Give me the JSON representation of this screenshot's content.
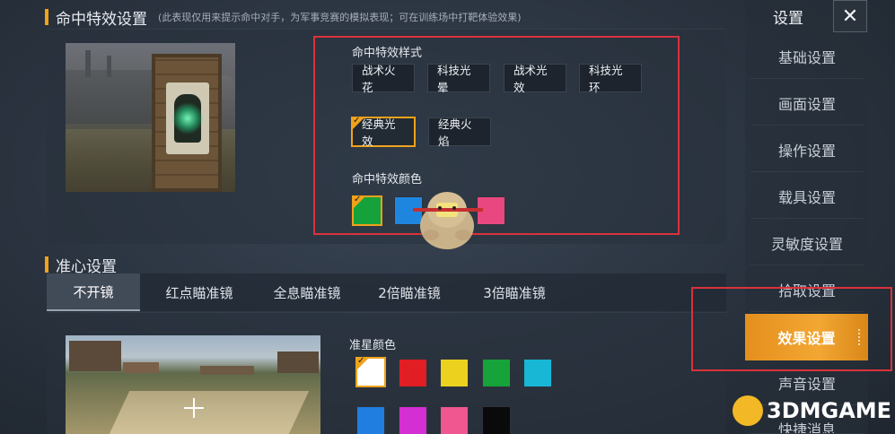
{
  "hit_section": {
    "title": "命中特效设置",
    "note": "(此表现仅用来提示命中对手，为军事竞赛的模拟表现；可在训练场中打靶体验效果)",
    "style_label": "命中特效样式",
    "styles": [
      {
        "label": "战术火花",
        "selected": false
      },
      {
        "label": "科技光晕",
        "selected": false
      },
      {
        "label": "战术光效",
        "selected": false
      },
      {
        "label": "科技光环",
        "selected": false
      },
      {
        "label": "经典光效",
        "selected": true
      },
      {
        "label": "经典火焰",
        "selected": false
      }
    ],
    "color_label": "命中特效颜色",
    "colors": [
      {
        "color": "#16a23a",
        "selected": true
      },
      {
        "color": "#1f86e0",
        "selected": false
      },
      {
        "color": "#e8487f",
        "selected": false
      }
    ]
  },
  "crosshair_section": {
    "title": "准心设置",
    "tabs": [
      {
        "label": "不开镜",
        "active": true
      },
      {
        "label": "红点瞄准镜",
        "active": false
      },
      {
        "label": "全息瞄准镜",
        "active": false
      },
      {
        "label": "2倍瞄准镜",
        "active": false
      },
      {
        "label": "3倍瞄准镜",
        "active": false
      }
    ],
    "color_label": "准星颜色",
    "colors": [
      {
        "color": "#ffffff",
        "selected": true
      },
      {
        "color": "#e01e24",
        "selected": false
      },
      {
        "color": "#ecd21e",
        "selected": false
      },
      {
        "color": "#15a33a",
        "selected": false
      },
      {
        "color": "#18b7d6",
        "selected": false
      },
      {
        "color": "#1f7ee0",
        "selected": false
      },
      {
        "color": "#d42fd2",
        "selected": false
      },
      {
        "color": "#f0568f",
        "selected": false
      },
      {
        "color": "#0a0a0a",
        "selected": false
      }
    ]
  },
  "sidebar": {
    "title": "设置",
    "close_symbol": "✕",
    "items": [
      {
        "label": "基础设置",
        "active": false
      },
      {
        "label": "画面设置",
        "active": false
      },
      {
        "label": "操作设置",
        "active": false
      },
      {
        "label": "载具设置",
        "active": false
      },
      {
        "label": "灵敏度设置",
        "active": false
      },
      {
        "label": "拾取设置",
        "active": false
      },
      {
        "label": "效果设置",
        "active": true
      },
      {
        "label": "声音设置",
        "active": false
      },
      {
        "label": "快捷消息",
        "active": false
      }
    ]
  },
  "watermark": {
    "text": "3DMGAME"
  },
  "colors": {
    "accent": "#f0a21b",
    "annotation_red": "#d9323c"
  }
}
